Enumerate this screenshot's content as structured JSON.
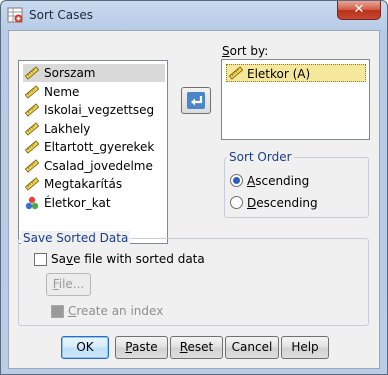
{
  "window": {
    "title": "Sort Cases",
    "close_label": "✕"
  },
  "variables": [
    {
      "label": "Sorszam",
      "icon": "scale-ruler-icon",
      "selected": true
    },
    {
      "label": "Neme",
      "icon": "scale-ruler-icon"
    },
    {
      "label": "Iskolai_vegzettseg",
      "icon": "scale-ruler-icon"
    },
    {
      "label": "Lakhely",
      "icon": "scale-ruler-icon"
    },
    {
      "label": "Eltartott_gyerekek",
      "icon": "scale-ruler-icon"
    },
    {
      "label": "Csalad_jovedelme",
      "icon": "scale-ruler-icon"
    },
    {
      "label": "Megtakarítás",
      "icon": "scale-ruler-icon"
    },
    {
      "label": "Életkor_kat",
      "icon": "nominal-balls-icon"
    }
  ],
  "sort_by": {
    "label_access": "S",
    "label_rest": "ort by:",
    "items": [
      {
        "label": "Eletkor (A)",
        "icon": "scale-ruler-icon"
      }
    ]
  },
  "move_button": {
    "icon": "arrow-left-icon"
  },
  "sort_order": {
    "legend": "Sort Order",
    "ascending": {
      "access": "A",
      "rest": "scending",
      "checked": true
    },
    "descending": {
      "access": "D",
      "rest": "escending",
      "checked": false
    }
  },
  "save": {
    "legend": "Save Sorted Data",
    "checkbox": {
      "pre": "Sa",
      "access": "v",
      "rest": "e file with sorted data",
      "checked": false
    },
    "file_button": {
      "access": "F",
      "rest": "ile..."
    },
    "index_checkbox": {
      "access": "C",
      "rest": "reate an index",
      "checked": false,
      "enabled": false
    }
  },
  "buttons": {
    "ok": "OK",
    "paste": {
      "access": "P",
      "rest": "aste"
    },
    "reset": {
      "access": "R",
      "rest": "eset"
    },
    "cancel": "Cancel",
    "help": "Help"
  },
  "colors": {
    "accent": "#2a5ebd",
    "selection": "#f6e89a",
    "group_title": "#1a3e8c"
  }
}
